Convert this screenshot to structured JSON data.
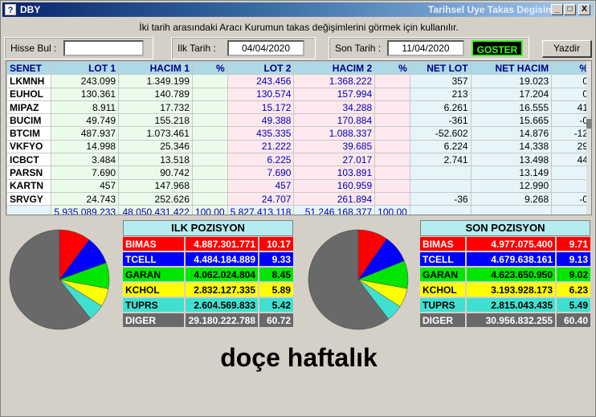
{
  "window": {
    "title": "DBY",
    "subtitle": "Tarihsel Uye Takas Degisimi",
    "icon": "app-icon",
    "buttons": [
      "_",
      "□",
      "X"
    ]
  },
  "hint": "İki tarih arasındaki  Aracı Kurumun takas değişimlerini görmek için kullanılır.",
  "toolbar": {
    "search_label": "Hisse Bul :",
    "search_value": "",
    "start_label": "Ilk Tarih :",
    "start_value": "04/04/2020",
    "end_label": "Son Tarih :",
    "end_value": "11/04/2020",
    "show_button": "GOSTER",
    "print_button": "Yazdir"
  },
  "grid": {
    "headers": [
      "SENET",
      "LOT 1",
      "HACIM 1",
      "%",
      "LOT 2",
      "HACIM 2",
      "%",
      "NET LOT",
      "NET HACIM",
      "%"
    ],
    "rows": [
      [
        "LKMNH",
        "243.099",
        "1.349.199",
        "",
        "243.456",
        "1.368.222",
        "",
        "357",
        "19.023",
        "0"
      ],
      [
        "EUHOL",
        "130.361",
        "140.789",
        "",
        "130.574",
        "157.994",
        "",
        "213",
        "17.204",
        "0"
      ],
      [
        "MIPAZ",
        "8.911",
        "17.732",
        "",
        "15.172",
        "34.288",
        "",
        "6.261",
        "16.555",
        "41"
      ],
      [
        "BUCIM",
        "49.749",
        "155.218",
        "",
        "49.388",
        "170.884",
        "",
        "-361",
        "15.665",
        "-0"
      ],
      [
        "BTCIM",
        "487.937",
        "1.073.461",
        "",
        "435.335",
        "1.088.337",
        "",
        "-52.602",
        "14.876",
        "-12"
      ],
      [
        "VKFYO",
        "14.998",
        "25.346",
        "",
        "21.222",
        "39.685",
        "",
        "6.224",
        "14.338",
        "29"
      ],
      [
        "ICBCT",
        "3.484",
        "13.518",
        "",
        "6.225",
        "27.017",
        "",
        "2.741",
        "13.498",
        "44"
      ],
      [
        "PARSN",
        "7.690",
        "90.742",
        "",
        "7.690",
        "103.891",
        "",
        "",
        "13.149",
        ""
      ],
      [
        "KARTN",
        "457",
        "147.968",
        "",
        "457",
        "160.959",
        "",
        "",
        "12.990",
        ""
      ],
      [
        "SRVGY",
        "24.743",
        "252.626",
        "",
        "24.707",
        "261.894",
        "",
        "-36",
        "9.268",
        "-0"
      ]
    ],
    "totals": [
      "",
      "5.935.089.233",
      "48.050.431.422",
      "100,00",
      "5.827.413.118",
      "51.246.168.377",
      "100,00",
      "",
      "",
      ""
    ]
  },
  "ilk_pozisyon": {
    "title": "ILK POZISYON",
    "rows": [
      {
        "name": "BIMAS",
        "value": "4.887.301.771",
        "pct": "10.17",
        "color": "#ff0000",
        "text": "#ffffff"
      },
      {
        "name": "TCELL",
        "value": "4.484.184.889",
        "pct": "9.33",
        "color": "#0000ff",
        "text": "#ffffff"
      },
      {
        "name": "GARAN",
        "value": "4.062.024.804",
        "pct": "8.45",
        "color": "#00e600",
        "text": "#000000"
      },
      {
        "name": "KCHOL",
        "value": "2.832.127.335",
        "pct": "5.89",
        "color": "#ffff00",
        "text": "#000000"
      },
      {
        "name": "TUPRS",
        "value": "2.604.569.833",
        "pct": "5.42",
        "color": "#40e0d0",
        "text": "#000000"
      },
      {
        "name": "DIGER",
        "value": "29.180.222.788",
        "pct": "60.72",
        "color": "#696969",
        "text": "#ffffff"
      }
    ]
  },
  "son_pozisyon": {
    "title": "SON POZISYON",
    "rows": [
      {
        "name": "BIMAS",
        "value": "4.977.075.400",
        "pct": "9.71",
        "color": "#ff0000",
        "text": "#ffffff"
      },
      {
        "name": "TCELL",
        "value": "4.679.638.161",
        "pct": "9.13",
        "color": "#0000ff",
        "text": "#ffffff"
      },
      {
        "name": "GARAN",
        "value": "4.623.650.950",
        "pct": "9.02",
        "color": "#00e600",
        "text": "#000000"
      },
      {
        "name": "KCHOL",
        "value": "3.193.928.173",
        "pct": "6.23",
        "color": "#ffff00",
        "text": "#000000"
      },
      {
        "name": "TUPRS",
        "value": "2.815.043.435",
        "pct": "5.49",
        "color": "#40e0d0",
        "text": "#000000"
      },
      {
        "name": "DIGER",
        "value": "30.956.832.255",
        "pct": "60.40",
        "color": "#696969",
        "text": "#ffffff"
      }
    ]
  },
  "caption": "doçe haftalık"
}
